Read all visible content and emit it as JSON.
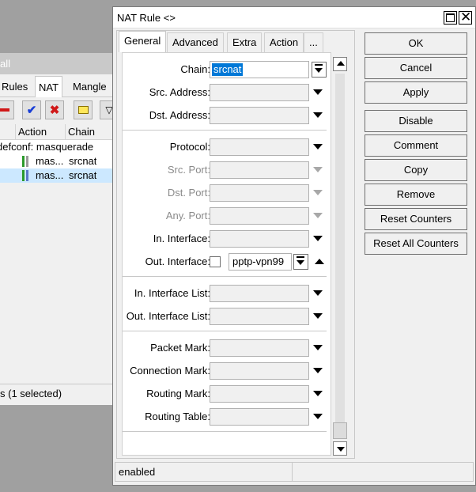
{
  "bg_window": {
    "title_fragment": "all",
    "tabs": [
      "Rules",
      "NAT",
      "Mangle"
    ],
    "active_tab": "NAT",
    "columns": [
      "Action",
      "Chain"
    ],
    "rows": [
      {
        "prefix": "defconf:",
        "action": "masquerade",
        "chain": ""
      },
      {
        "prefix": "",
        "action": "mas...",
        "chain": "srcnat"
      },
      {
        "prefix": "",
        "action": "mas...",
        "chain": "srcnat"
      }
    ],
    "status": "s (1 selected)"
  },
  "window": {
    "title": "NAT Rule <>",
    "tabs": [
      "General",
      "Advanced",
      "Extra",
      "Action",
      "..."
    ],
    "active_tab": "General"
  },
  "form": {
    "chain": {
      "label": "Chain:",
      "value": "srcnat"
    },
    "src_address": {
      "label": "Src. Address:"
    },
    "dst_address": {
      "label": "Dst. Address:"
    },
    "protocol": {
      "label": "Protocol:"
    },
    "src_port": {
      "label": "Src. Port:"
    },
    "dst_port": {
      "label": "Dst. Port:"
    },
    "any_port": {
      "label": "Any. Port:"
    },
    "in_interface": {
      "label": "In. Interface:"
    },
    "out_interface": {
      "label": "Out. Interface:",
      "value": "pptp-vpn99"
    },
    "in_interface_list": {
      "label": "In. Interface List:"
    },
    "out_interface_list": {
      "label": "Out. Interface List:"
    },
    "packet_mark": {
      "label": "Packet Mark:"
    },
    "connection_mark": {
      "label": "Connection Mark:"
    },
    "routing_mark": {
      "label": "Routing Mark:"
    },
    "routing_table": {
      "label": "Routing Table:"
    }
  },
  "buttons": {
    "ok": "OK",
    "cancel": "Cancel",
    "apply": "Apply",
    "disable": "Disable",
    "comment": "Comment",
    "copy": "Copy",
    "remove": "Remove",
    "reset_counters": "Reset Counters",
    "reset_all_counters": "Reset All Counters"
  },
  "status": {
    "state": "enabled"
  },
  "colors": {
    "selection": "#0078d7",
    "row_selected": "#cce8ff",
    "remove_red": "#d01818",
    "enable_blue": "#1a3fd6"
  }
}
